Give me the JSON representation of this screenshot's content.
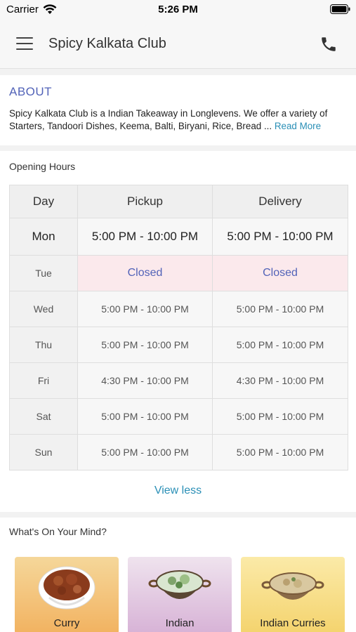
{
  "status_bar": {
    "carrier": "Carrier",
    "time": "5:26 PM"
  },
  "header": {
    "title": "Spicy Kalkata Club",
    "menu_icon": "hamburger-menu-icon",
    "call_icon": "phone-icon"
  },
  "about": {
    "title": "ABOUT",
    "text": "Spicy Kalkata Club is a Indian Takeaway in Longlevens. We offer a variety of Starters, Tandoori Dishes, Keema, Balti, Biryani, Rice, Bread ...",
    "read_more": "Read More"
  },
  "opening_hours": {
    "title": "Opening Hours",
    "columns": [
      "Day",
      "Pickup",
      "Delivery"
    ],
    "rows": [
      {
        "day": "Mon",
        "pickup": "5:00 PM - 10:00 PM",
        "delivery": "5:00 PM - 10:00 PM"
      },
      {
        "day": "Tue",
        "pickup": "Closed",
        "delivery": "Closed"
      },
      {
        "day": "Wed",
        "pickup": "5:00 PM - 10:00 PM",
        "delivery": "5:00 PM - 10:00 PM"
      },
      {
        "day": "Thu",
        "pickup": "5:00 PM - 10:00 PM",
        "delivery": "5:00 PM - 10:00 PM"
      },
      {
        "day": "Fri",
        "pickup": "4:30 PM - 10:00 PM",
        "delivery": "4:30 PM - 10:00 PM"
      },
      {
        "day": "Sat",
        "pickup": "5:00 PM - 10:00 PM",
        "delivery": "5:00 PM - 10:00 PM"
      },
      {
        "day": "Sun",
        "pickup": "5:00 PM - 10:00 PM",
        "delivery": "5:00 PM - 10:00 PM"
      }
    ],
    "view_less": "View less"
  },
  "mind": {
    "title": "What's On Your Mind?",
    "categories": [
      {
        "label": "Curry",
        "icon": "curry-bowl-icon",
        "color_top": "#f5d79a",
        "color_bottom": "#f2b260"
      },
      {
        "label": "Indian",
        "icon": "kadai-dish-icon",
        "color_top": "#efe3ee",
        "color_bottom": "#d7b2d6"
      },
      {
        "label": "Indian Curries",
        "icon": "kadai-curry-icon",
        "color_top": "#fbeaa8",
        "color_bottom": "#f4d36d"
      }
    ]
  },
  "colors": {
    "accent": "#5263b8",
    "link": "#2a8fb6",
    "closed_bg": "#fbe9ec"
  }
}
